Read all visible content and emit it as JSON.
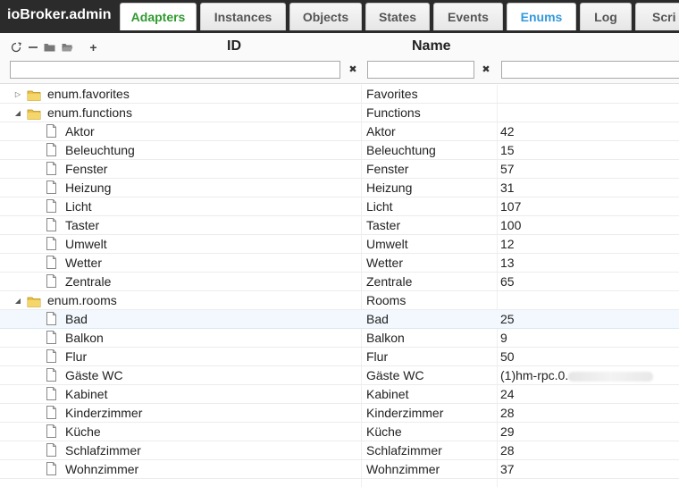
{
  "app": {
    "title": "ioBroker.admin"
  },
  "tabs": [
    {
      "label": "Adapters",
      "state": "green"
    },
    {
      "label": "Instances",
      "state": "normal"
    },
    {
      "label": "Objects",
      "state": "normal"
    },
    {
      "label": "States",
      "state": "normal"
    },
    {
      "label": "Events",
      "state": "normal"
    },
    {
      "label": "Enums",
      "state": "active"
    },
    {
      "label": "Log",
      "state": "normal"
    },
    {
      "label": "Scri",
      "state": "normal"
    }
  ],
  "columns": {
    "id": "ID",
    "name": "Name"
  },
  "toolbar": {
    "refresh_icon": "refresh-icon",
    "collapse_icon": "collapse-all-icon",
    "expand_icon": "folder-closed-icon",
    "open_icon": "folder-open-icon",
    "add_label": "+"
  },
  "filters": {
    "id_value": "",
    "name_value": "",
    "clear_symbol": "✖"
  },
  "tree": [
    {
      "id": "enum.favorites",
      "name": "Favorites",
      "extra": "",
      "type": "folder",
      "expanded": false
    },
    {
      "id": "enum.functions",
      "name": "Functions",
      "extra": "",
      "type": "folder",
      "expanded": true
    },
    {
      "id": "Aktor",
      "name": "Aktor",
      "extra": "42",
      "type": "file"
    },
    {
      "id": "Beleuchtung",
      "name": "Beleuchtung",
      "extra": "15",
      "type": "file"
    },
    {
      "id": "Fenster",
      "name": "Fenster",
      "extra": "57",
      "type": "file"
    },
    {
      "id": "Heizung",
      "name": "Heizung",
      "extra": "31",
      "type": "file"
    },
    {
      "id": "Licht",
      "name": "Licht",
      "extra": "107",
      "type": "file"
    },
    {
      "id": "Taster",
      "name": "Taster",
      "extra": "100",
      "type": "file"
    },
    {
      "id": "Umwelt",
      "name": "Umwelt",
      "extra": "12",
      "type": "file"
    },
    {
      "id": "Wetter",
      "name": "Wetter",
      "extra": "13",
      "type": "file"
    },
    {
      "id": "Zentrale",
      "name": "Zentrale",
      "extra": "65",
      "type": "file"
    },
    {
      "id": "enum.rooms",
      "name": "Rooms",
      "extra": "",
      "type": "folder",
      "expanded": true
    },
    {
      "id": "Bad",
      "name": "Bad",
      "extra": "25",
      "type": "file",
      "selected": true
    },
    {
      "id": "Balkon",
      "name": "Balkon",
      "extra": "9",
      "type": "file"
    },
    {
      "id": "Flur",
      "name": "Flur",
      "extra": "50",
      "type": "file"
    },
    {
      "id": "Gäste WC",
      "name": "Gäste WC",
      "extra": "(1)hm-rpc.0.",
      "type": "file",
      "blurred": true
    },
    {
      "id": "Kabinet",
      "name": "Kabinet",
      "extra": "24",
      "type": "file"
    },
    {
      "id": "Kinderzimmer",
      "name": "Kinderzimmer",
      "extra": "28",
      "type": "file"
    },
    {
      "id": "Küche",
      "name": "Küche",
      "extra": "29",
      "type": "file"
    },
    {
      "id": "Schlafzimmer",
      "name": "Schlafzimmer",
      "extra": "28",
      "type": "file"
    },
    {
      "id": "Wohnzimmer",
      "name": "Wohnzimmer",
      "extra": "37",
      "type": "file"
    }
  ]
}
